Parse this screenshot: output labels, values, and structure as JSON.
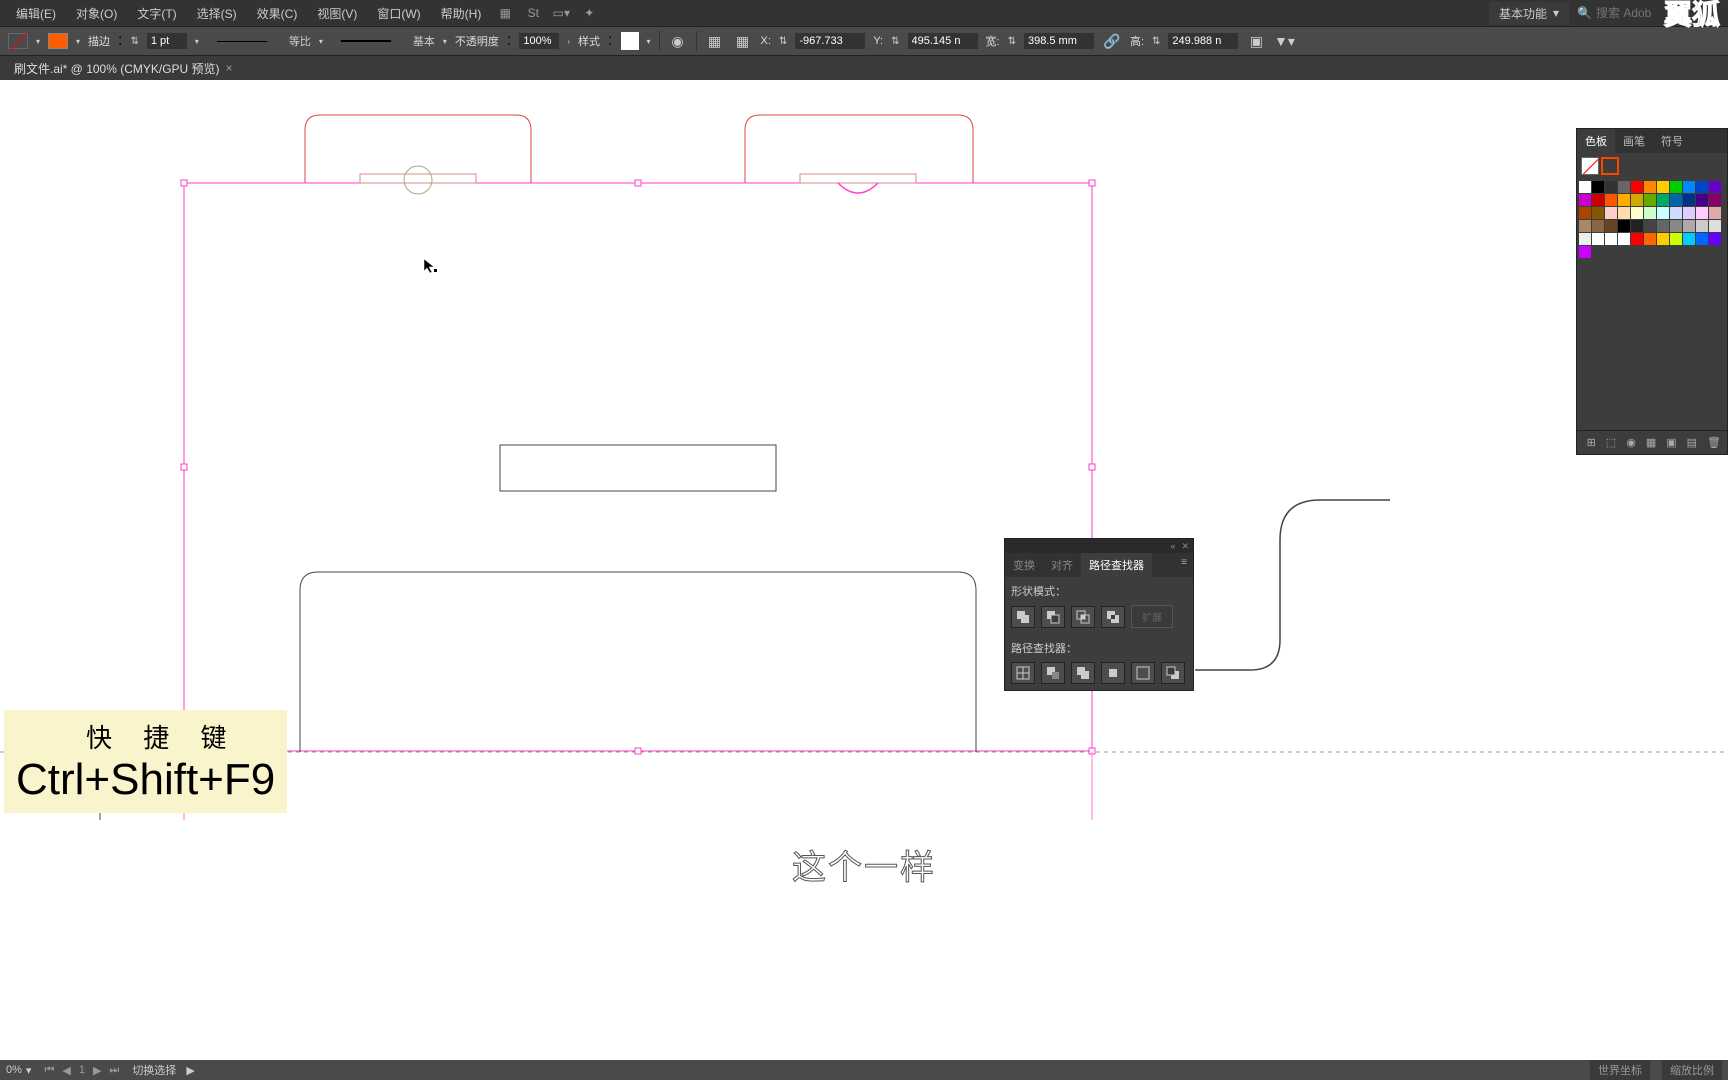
{
  "menu": {
    "items": [
      "编辑(E)",
      "对象(O)",
      "文字(T)",
      "选择(S)",
      "效果(C)",
      "视图(V)",
      "窗口(W)",
      "帮助(H)"
    ]
  },
  "workspace": {
    "label": "基本功能"
  },
  "search": {
    "placeholder": "搜索 Adob"
  },
  "logo": {
    "text": "翼狐"
  },
  "options": {
    "stroke_label": "描边",
    "stroke_weight": "1 pt",
    "dash_label": "等比",
    "profile_label": "基本",
    "opacity_label": "不透明度",
    "opacity_value": "100%",
    "style_label": "样式",
    "x_label": "X:",
    "x_value": "-967.733",
    "y_label": "Y:",
    "y_value": "495.145 n",
    "w_label": "宽:",
    "w_value": "398.5 mm",
    "h_label": "高:",
    "h_value": "249.988 n"
  },
  "tab": {
    "title": "刷文件.ai* @ 100% (CMYK/GPU 预览)"
  },
  "shortcut": {
    "label": "快 捷 键",
    "keys": "Ctrl+Shift+F9"
  },
  "caption": "这个一样",
  "swatches": {
    "tabs": [
      "色板",
      "画笔",
      "符号"
    ],
    "colors": [
      "#ffffff",
      "#000000",
      "#333333",
      "#666666",
      "#ff0000",
      "#ff8800",
      "#ffcc00",
      "#00cc00",
      "#0088ff",
      "#0044cc",
      "#6600cc",
      "#cc00cc",
      "#cc0000",
      "#ff5500",
      "#ffaa00",
      "#ccaa00",
      "#66aa00",
      "#00aa66",
      "#0066aa",
      "#003388",
      "#440088",
      "#880066",
      "#aa4400",
      "#885500",
      "#ffcccc",
      "#ffddaa",
      "#ffffcc",
      "#ccffcc",
      "#ccffff",
      "#ccddff",
      "#ddccff",
      "#ffccff",
      "#ddaaaa",
      "#aa8866",
      "#886644",
      "#664422",
      "#000000",
      "#222222",
      "#444444",
      "#666666",
      "#888888",
      "#aaaaaa",
      "#cccccc",
      "#dddddd",
      "#eeeeee",
      "#ffffff",
      "#ffffff",
      "#ffffff",
      "#ff0000",
      "#ff6600",
      "#ffcc00",
      "#ccff00",
      "#00ccff",
      "#0066ff",
      "#6600ff",
      "#cc00ff"
    ]
  },
  "pathfinder": {
    "tabs": [
      "变换",
      "对齐",
      "路径查找器"
    ],
    "shape_modes_label": "形状模式：",
    "pathfinders_label": "路径查找器：",
    "expand_label": "扩展"
  },
  "status": {
    "zoom": "0%",
    "tool": "切换选择",
    "coord_label": "世界坐标",
    "scale_label": "缩放比例"
  }
}
